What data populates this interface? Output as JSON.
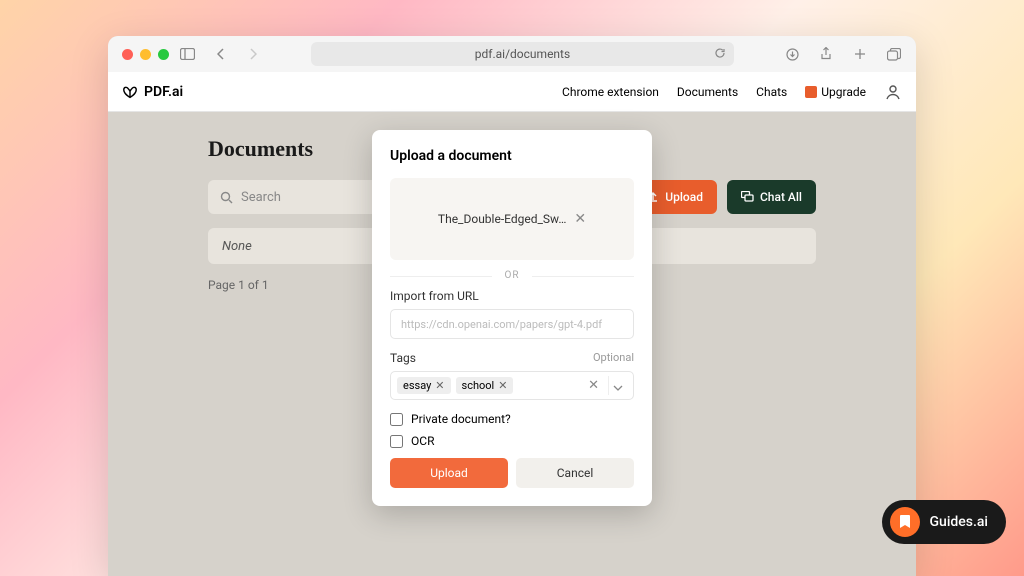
{
  "browser": {
    "url": "pdf.ai/documents"
  },
  "app": {
    "logo_text": "PDF.ai",
    "nav": {
      "chrome_ext": "Chrome extension",
      "documents": "Documents",
      "chats": "Chats",
      "upgrade": "Upgrade"
    }
  },
  "page": {
    "title": "Documents",
    "search_placeholder": "Search",
    "upload_btn": "Upload",
    "chat_all_btn": "Chat All",
    "empty_text": "None",
    "pagination": "Page 1 of 1"
  },
  "modal": {
    "title": "Upload a document",
    "file_name": "The_Double-Edged_Sw…",
    "divider": "OR",
    "url_label": "Import from URL",
    "url_placeholder": "https://cdn.openai.com/papers/gpt-4.pdf",
    "tags_label": "Tags",
    "tags_optional": "Optional",
    "tags": [
      "essay",
      "school"
    ],
    "private_label": "Private document?",
    "ocr_label": "OCR",
    "upload_btn": "Upload",
    "cancel_btn": "Cancel"
  },
  "guides_badge": "Guides.ai"
}
